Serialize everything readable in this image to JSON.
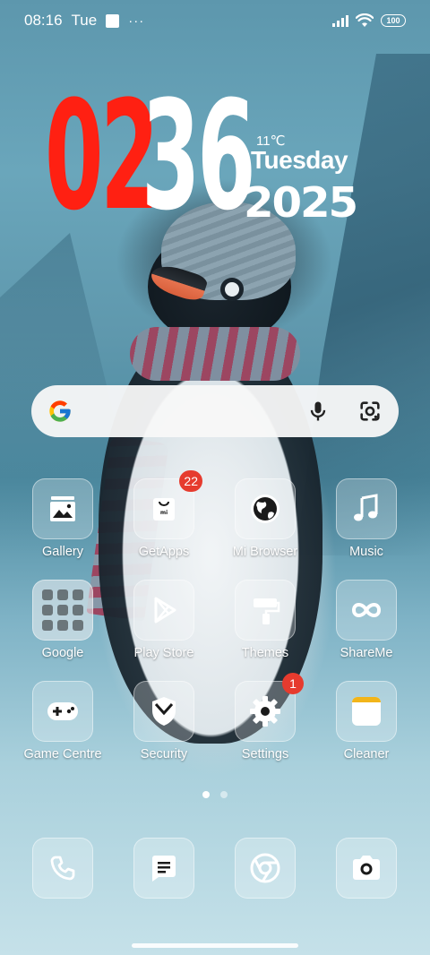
{
  "status_bar": {
    "time": "08:16",
    "day": "Tue",
    "more": "···",
    "battery": "100"
  },
  "clock": {
    "hours": "02",
    "minutes": "36",
    "temperature": "11℃",
    "weekday": "Tuesday",
    "year": "2025",
    "colors": {
      "hours": "#ff2012",
      "minutes": "#ffffff"
    }
  },
  "search": {
    "icons": [
      "google-logo",
      "mic-icon",
      "google-lens-icon"
    ]
  },
  "apps": [
    {
      "label": "Gallery",
      "icon": "gallery-icon"
    },
    {
      "label": "GetApps",
      "icon": "getapps-icon",
      "badge": "22"
    },
    {
      "label": "Mi Browser",
      "icon": "browser-globe-icon"
    },
    {
      "label": "Music",
      "icon": "music-note-icon"
    },
    {
      "label": "Google",
      "icon": "google-folder-icon"
    },
    {
      "label": "Play Store",
      "icon": "play-store-icon"
    },
    {
      "label": "Themes",
      "icon": "paint-roller-icon"
    },
    {
      "label": "ShareMe",
      "icon": "infinity-icon"
    },
    {
      "label": "Game Centre",
      "icon": "gamepad-icon"
    },
    {
      "label": "Security",
      "icon": "shield-icon"
    },
    {
      "label": "Settings",
      "icon": "gear-icon",
      "badge": "1"
    },
    {
      "label": "Cleaner",
      "icon": "cleaner-icon"
    }
  ],
  "dock": [
    {
      "icon": "phone-icon"
    },
    {
      "icon": "messages-icon"
    },
    {
      "icon": "chrome-icon"
    },
    {
      "icon": "camera-icon"
    }
  ],
  "pages": {
    "count": 2,
    "active": 1
  },
  "accent_colors": {
    "badge": "#e63b2e",
    "clock_red": "#ff2012"
  }
}
